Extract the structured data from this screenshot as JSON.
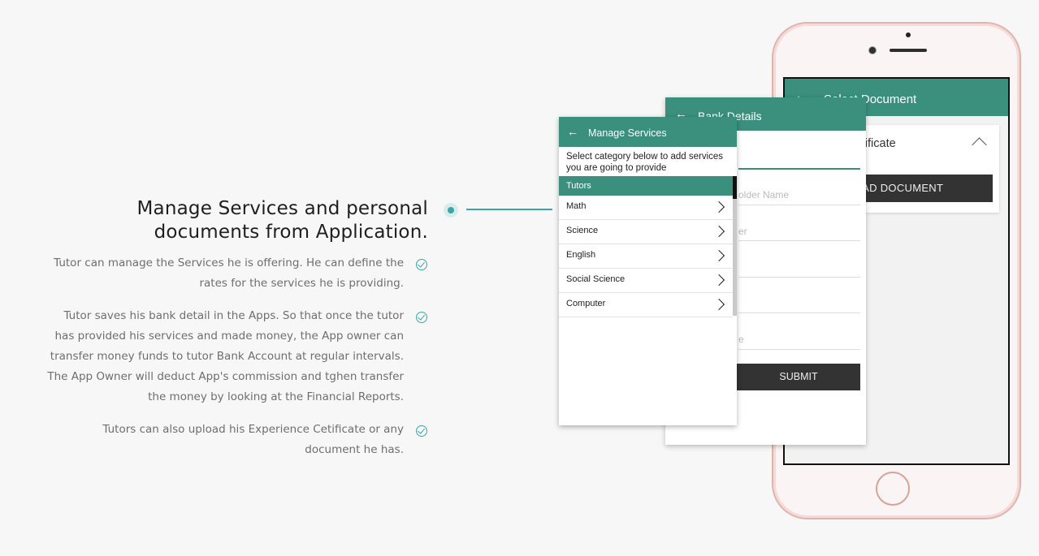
{
  "feature_section": {
    "heading": "Manage Services and personal documents from Application.",
    "points": [
      "Tutor can manage the Services he is offering. He can define the rates for the services he is providing.",
      "Tutor saves his bank detail in the Apps. So that once the tutor has provided his services and made money, the App owner can transfer money funds to tutor Bank Account at regular intervals. The App Owner will deduct App's commission and tghen transfer the money by looking at the Financial Reports.",
      "Tutors can also upload his Experience Cetificate or any document he has."
    ],
    "accent_color": "#3aa6a5"
  },
  "select_document_screen": {
    "title": "Select Document",
    "back_icon": "arrow-left-icon",
    "card_label": "nce Certificate",
    "expand_icon": "chevron-up-icon",
    "upload_button": "OAD DOCUMENT"
  },
  "bank_details_screen": {
    "title": "Bank Details",
    "fields": [
      "older Name",
      "er",
      "",
      "",
      "e"
    ],
    "submit_button": "SUBMIT"
  },
  "manage_services_screen": {
    "title": "Manage Services",
    "intro": "Select category below to add services you are going to provide",
    "category_header": "Tutors",
    "items": [
      "Math",
      "Science",
      "English",
      "Social Science",
      "Computer"
    ],
    "bar_color": "#3a8f7d"
  }
}
